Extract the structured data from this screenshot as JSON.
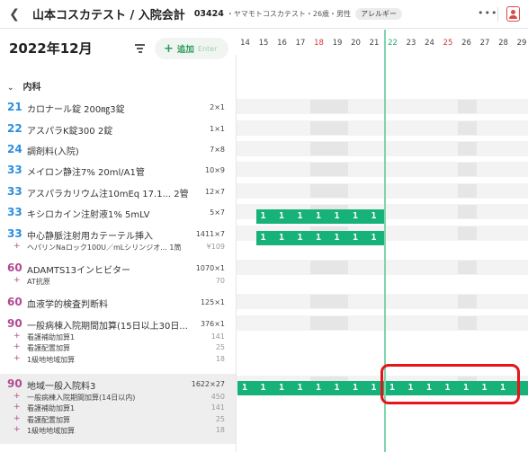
{
  "header": {
    "back_icon": "chevron-left-icon",
    "title": "山本コスカテスト / 入院会計",
    "patient_id": "03424",
    "patient_info": "・ヤマモトコスカテスト・26歳・男性",
    "allergy_badge": "アレルギー",
    "more": "•••",
    "accent_red": "#d64b4b"
  },
  "sidebar": {
    "month": "2022年12月",
    "add_label": "追加",
    "add_key": "Enter",
    "category": "内科",
    "accent_green": "#2a9b58"
  },
  "items": [
    {
      "code": "21",
      "name": "カロナール錠 200㎎3錠",
      "qty": "2×1",
      "code_color": "#2b8ee0",
      "subs": []
    },
    {
      "code": "22",
      "name": "アスパラK錠300 2錠",
      "qty": "1×1",
      "code_color": "#2b8ee0",
      "subs": []
    },
    {
      "code": "24",
      "name": "調剤料(入院)",
      "qty": "7×8",
      "code_color": "#2b8ee0",
      "subs": []
    },
    {
      "code": "33",
      "name": "メイロン静注7% 20ml/A1管",
      "qty": "10×9",
      "code_color": "#2b8ee0",
      "subs": []
    },
    {
      "code": "33",
      "name": "アスパラカリウム注10mEq 17.1...  2管",
      "qty": "12×7",
      "code_color": "#2b8ee0",
      "subs": []
    },
    {
      "code": "33",
      "name": "キシロカイン注射液1% 5mLV",
      "qty": "5×7",
      "code_color": "#2b8ee0",
      "subs": []
    },
    {
      "code": "33",
      "name": "中心静脈注射用カテーテル挿入",
      "qty": "1411×7",
      "code_color": "#2b8ee0",
      "subs": [
        {
          "name": "ヘパリンNaロック100U／mLシリンジオ... 1筒",
          "qty": "¥109"
        }
      ]
    },
    {
      "code": "60",
      "name": "ADAMTS13インヒビター",
      "qty": "1070×1",
      "code_color": "#b04a90",
      "subs": [
        {
          "name": "AT抗原",
          "qty": "70"
        }
      ]
    },
    {
      "code": "60",
      "name": "血液学的検査判断料",
      "qty": "125×1",
      "code_color": "#b04a90",
      "subs": []
    },
    {
      "code": "90",
      "name": "一般病棟入院期間加算(15日以上30日...",
      "qty": "376×1",
      "code_color": "#b04a90",
      "subs": [
        {
          "name": "看護補助加算1",
          "qty": "141"
        },
        {
          "name": "看護配置加算",
          "qty": "25"
        },
        {
          "name": "1級地地域加算",
          "qty": "18"
        }
      ]
    },
    {
      "code": "90",
      "name": "地域一般入院料3",
      "qty": "1622×27",
      "code_color": "#b04a90",
      "subs": [
        {
          "name": "一般病棟入院期間加算(14日以内)",
          "qty": "450"
        },
        {
          "name": "看護補助加算1",
          "qty": "141"
        },
        {
          "name": "看護配置加算",
          "qty": "25"
        },
        {
          "name": "1級地地域加算",
          "qty": "18"
        }
      ]
    }
  ],
  "calendar": {
    "days": [
      "14",
      "15",
      "16",
      "17",
      "18",
      "19",
      "20",
      "21",
      "22",
      "23",
      "24",
      "25",
      "26",
      "27",
      "28",
      "29"
    ],
    "red_days": [
      "18",
      "25"
    ],
    "today": "22",
    "bar_color": "#16b27a",
    "bars": [
      {
        "item": 5,
        "start_day": "15",
        "end_day": "21",
        "cells": [
          "1",
          "1",
          "1",
          "1",
          "1",
          "1",
          "1"
        ]
      },
      {
        "item": 6,
        "start_day": "15",
        "end_day": "21",
        "cells": [
          "1",
          "1",
          "1",
          "1",
          "1",
          "1",
          "1"
        ]
      },
      {
        "item": 10,
        "start_day": "14",
        "end_day": "29",
        "cells": [
          "1",
          "1",
          "1",
          "1",
          "1",
          "1",
          "1",
          "1",
          "1",
          "1",
          "1",
          "1",
          "1",
          "1",
          "1"
        ]
      }
    ],
    "highlight_color": "#e5151b"
  }
}
